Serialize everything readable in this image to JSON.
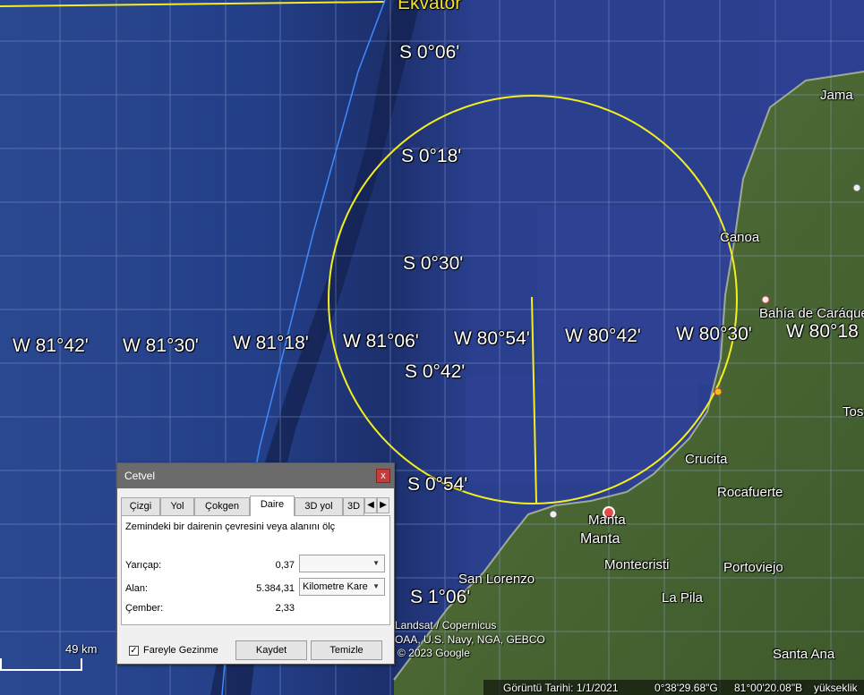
{
  "map": {
    "equator_label": "Ekvator",
    "latitude_labels": [
      "S 0°06'",
      "S 0°18'",
      "S 0°30'",
      "S 0°42'",
      "S 0°54'",
      "S 1°06'"
    ],
    "longitude_labels": [
      "W 81°42'",
      "W 81°30'",
      "W 81°18'",
      "W 81°06'",
      "W 80°54'",
      "W 80°42'",
      "W 80°30'",
      "W 80°18"
    ],
    "places": [
      "Jama",
      "Canoa",
      "Bahía de Caráquez",
      "Tos",
      "Crucita",
      "Rocafuerte",
      "Manta",
      "Manta",
      "San Lorenzo",
      "Montecristi",
      "Portoviejo",
      "La Pila",
      "Santa Ana"
    ],
    "credits": [
      "Landsat / Copernicus",
      "OAA, U.S. Navy, NGA, GEBCO",
      "© 2023 Google"
    ],
    "scale_label": "49 km",
    "status": {
      "date": "Görüntü Tarihi: 1/1/2021",
      "lat": "0°38'29.68\"G",
      "lon": "81°00'20.08\"B",
      "elev": "yükseklik"
    },
    "colors": {
      "circle": "#f5ee1e",
      "ocean": "#1f3a88",
      "land": "#4e6a35",
      "trench_line": "#3d8bff"
    }
  },
  "dialog": {
    "title": "Cetvel",
    "close": "x",
    "tabs": [
      "Çizgi",
      "Yol",
      "Çokgen",
      "Daire",
      "3D yol",
      "3D"
    ],
    "active_tab": "Daire",
    "description": "Zemindeki bir dairenin çevresini veya alanını ölç",
    "radius_label": "Yarıçap:",
    "radius_value": "0,37",
    "radius_unit": "",
    "area_label": "Alan:",
    "area_value": "5.384,31",
    "area_unit": "Kilometre Kare",
    "circ_label": "Çember:",
    "circ_value": "2,33",
    "mouse_nav_label": "Fareyle Gezinme",
    "mouse_nav_checked": "✓",
    "save_label": "Kaydet",
    "clear_label": "Temizle"
  }
}
